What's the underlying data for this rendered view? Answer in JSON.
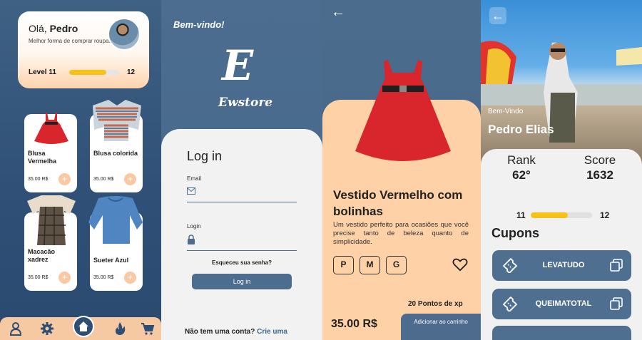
{
  "home": {
    "greeting_prefix": "Olá,",
    "greeting_name": "Pedro",
    "subtitle": "Melhor forma de comprar roupas",
    "level_label": "Level 11",
    "level_next": "12",
    "level_progress": 0.74,
    "products": [
      {
        "name": "Blusa Vermelha",
        "price": "35.00 R$",
        "add": "+"
      },
      {
        "name": "Blusa colorida",
        "price": "35.00 R$",
        "add": "+"
      },
      {
        "name": "Macacão xadrez",
        "price": "35.00 R$",
        "add": "+"
      },
      {
        "name": "Sueter Azul",
        "price": "35.00 R$",
        "add": "+"
      }
    ],
    "nav_icons": [
      "user-icon",
      "gear-icon",
      "home-icon",
      "fire-icon",
      "cart-icon"
    ]
  },
  "login": {
    "welcome": "Bem-vindo!",
    "logo_letter": "E",
    "logo_name": "Ewstore",
    "title": "Log in",
    "email_label": "Email",
    "login_label": "Login",
    "forgot": "Esqueceu sua senha?",
    "button": "Log in",
    "signup_prefix": "Não tem uma conta?",
    "signup_link": "Crie uma"
  },
  "product": {
    "title": "Vestido Vermelho com bolinhas",
    "description": "Um vestido perfeito para ocasiões que você precise tanto de beleza quanto de simplicidade.",
    "sizes": [
      "P",
      "M",
      "G"
    ],
    "xp": "20 Pontos de xp",
    "price": "35.00 R$",
    "cart_button": "Adicionar ao carrinho"
  },
  "profile": {
    "welcome": "Bem-Vindo",
    "name": "Pedro Elias",
    "rank_label": "Rank",
    "rank_value": "62°",
    "score_label": "Score",
    "score_value": "1632",
    "level_current": "11",
    "level_next": "12",
    "level_progress": 0.6,
    "coupons_title": "Cupons",
    "coupons": [
      "LEVATUDO",
      "QUEIMATOTAL"
    ]
  },
  "colors": {
    "primary_blue": "#4d6d8f",
    "peach": "#ffd1a7",
    "accent_yellow": "#f7c118",
    "dress_red": "#d9262c"
  }
}
